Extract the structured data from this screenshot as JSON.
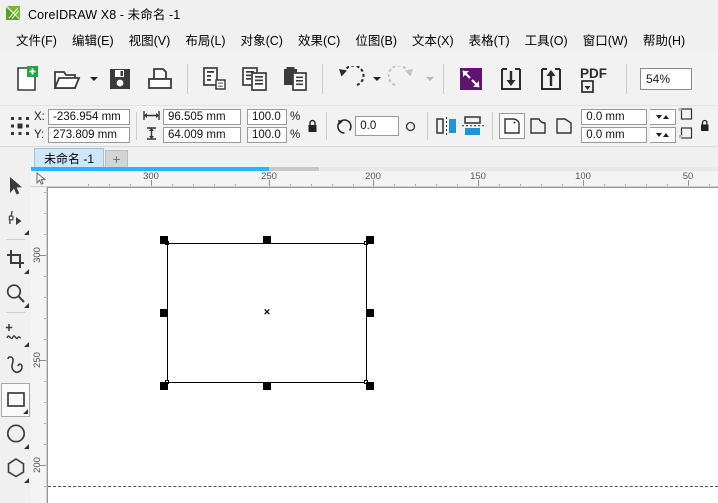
{
  "window": {
    "title": "CoreIDRAW X8 - 未命名 -1",
    "logo_icon": "coreldraw-logo-icon"
  },
  "menubar": [
    {
      "label": "文件(F)",
      "name": "menu-file"
    },
    {
      "label": "编辑(E)",
      "name": "menu-edit"
    },
    {
      "label": "视图(V)",
      "name": "menu-view"
    },
    {
      "label": "布局(L)",
      "name": "menu-layout"
    },
    {
      "label": "对象(C)",
      "name": "menu-object"
    },
    {
      "label": "效果(C)",
      "name": "menu-effects"
    },
    {
      "label": "位图(B)",
      "name": "menu-bitmap"
    },
    {
      "label": "文本(X)",
      "name": "menu-text"
    },
    {
      "label": "表格(T)",
      "name": "menu-table"
    },
    {
      "label": "工具(O)",
      "name": "menu-tools"
    },
    {
      "label": "窗口(W)",
      "name": "menu-window"
    },
    {
      "label": "帮助(H)",
      "name": "menu-help"
    }
  ],
  "toolbar": {
    "buttons": [
      {
        "name": "new-document-button",
        "icon": "new-page-icon"
      },
      {
        "name": "open-document-button",
        "icon": "folder-open-icon"
      },
      {
        "name": "save-document-button",
        "icon": "floppy-disk-icon"
      },
      {
        "name": "print-button",
        "icon": "printer-icon"
      },
      {
        "name": "cut-button",
        "icon": "cut-icon"
      },
      {
        "name": "copy-button",
        "icon": "copy-icon"
      },
      {
        "name": "paste-button",
        "icon": "paste-icon"
      },
      {
        "name": "undo-button",
        "icon": "undo-arrow-icon"
      },
      {
        "name": "redo-button",
        "icon": "redo-arrow-icon"
      },
      {
        "name": "search-content-button",
        "icon": "purple-connect-icon"
      },
      {
        "name": "import-button",
        "icon": "import-down-arrow-icon"
      },
      {
        "name": "export-button",
        "icon": "export-up-arrow-icon"
      },
      {
        "name": "export-pdf-button",
        "icon": "pdf-export-icon"
      }
    ],
    "zoom_level": "54%",
    "pdf_label": "PDF"
  },
  "propertybar": {
    "object_icon": "object-position-icon",
    "x_label": "X:",
    "y_label": "Y:",
    "x_value": "-236.954 mm",
    "y_value": "273.809 mm",
    "width_value": "96.505 mm",
    "height_value": "64.009 mm",
    "scale_x": "100.0",
    "scale_y": "100.0",
    "percent_sign": "%",
    "lock_ratio_icon": "lock-closed-icon",
    "rotation_value": "0.0",
    "rotation_icon": "rotate-icon",
    "anchor_icon": "anchor-circle-icon",
    "mirror_h_icon": "mirror-horizontal-icon",
    "mirror_v_icon": "mirror-vertical-icon",
    "corner_round_icon": "corner-round-icon",
    "corner_scallop_icon": "corner-scallop-icon",
    "corner_chamfer_icon": "corner-chamfer-icon",
    "corner_radius_1": "0.0 mm",
    "corner_radius_2": "0.0 mm",
    "relative_corner_icon_1": "relative-corner-icon",
    "relative_corner_icon_2": "relative-corner-scale-icon",
    "edit_lock_icon": "lock-closed-icon"
  },
  "tabs": {
    "active": "未命名 -1",
    "add_label": "+"
  },
  "toolbox": [
    {
      "name": "tool-pick",
      "icon": "pick-arrow-icon",
      "active": false,
      "flyout": false
    },
    {
      "name": "tool-shape",
      "icon": "shape-node-edit-icon",
      "active": false,
      "flyout": true
    },
    {
      "name": "tool-crop",
      "icon": "crop-icon",
      "active": false,
      "flyout": true
    },
    {
      "name": "tool-zoom",
      "icon": "magnifier-icon",
      "active": false,
      "flyout": true
    },
    {
      "name": "tool-freehand",
      "icon": "freehand-curve-icon",
      "active": false,
      "flyout": true
    },
    {
      "name": "tool-smart-drawing",
      "icon": "smart-drawing-s-curve-icon",
      "active": false,
      "flyout": false
    },
    {
      "name": "tool-rectangle",
      "icon": "rectangle-icon",
      "active": true,
      "flyout": true
    },
    {
      "name": "tool-ellipse",
      "icon": "ellipse-icon",
      "active": false,
      "flyout": true
    },
    {
      "name": "tool-polygon",
      "icon": "polygon-icon",
      "active": false,
      "flyout": true
    }
  ],
  "rulers": {
    "horizontal_labels": [
      "300",
      "250",
      "200",
      "150",
      "100",
      "50"
    ],
    "vertical_labels": [
      "300",
      "250",
      "200"
    ],
    "unit": "mm"
  },
  "canvas": {
    "selection": {
      "name": "selected-rectangle",
      "handles": 8,
      "center_marker": "×"
    }
  }
}
